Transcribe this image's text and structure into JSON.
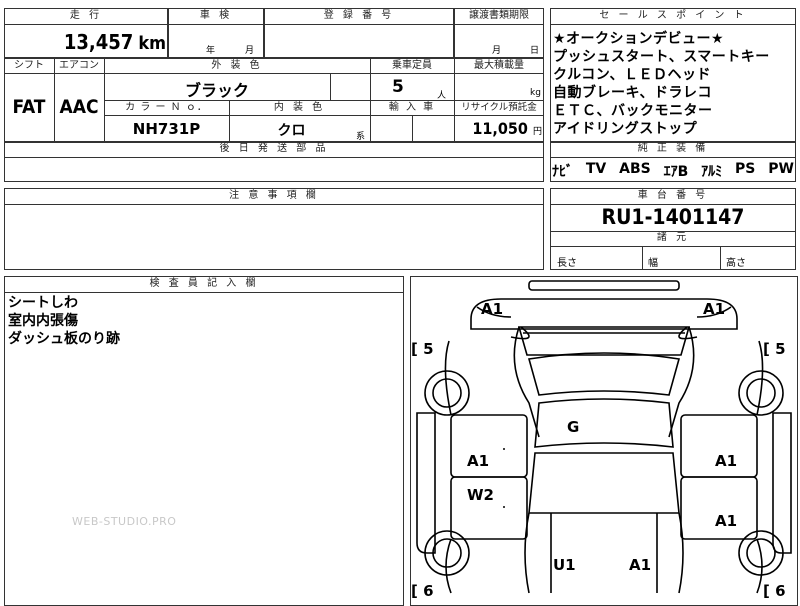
{
  "header": {
    "mileage_label": "走 行",
    "shaken_label": "車 検",
    "reg_label": "登 録 番 号",
    "transfer_label": "譲渡書類期限",
    "selling_label": "セ ー ル ス ポ イ ン ト"
  },
  "mileage": {
    "value": "13,457",
    "unit": "km"
  },
  "shaken": {
    "year_unit": "年",
    "month_unit": "月"
  },
  "transfer": {
    "month_unit": "月",
    "day_unit": "日"
  },
  "specs_headers": {
    "shift": "シフト",
    "aircon": "エアコン",
    "exterior": "外 装 色",
    "capacity": "乗車定員",
    "max_load": "最大積載量",
    "color_no": "カ ラ ー Ｎ ｏ．",
    "interior": "内 装 色",
    "import": "輸 入 車",
    "recycle": "リサイクル預託金"
  },
  "specs": {
    "shift": "FAT",
    "aircon": "AAC",
    "exterior_color": "ブラック",
    "capacity": "5",
    "capacity_unit": "人",
    "load_unit": "kg",
    "color_no": "NH731P",
    "interior_color": "クロ",
    "interior_suffix": "系",
    "recycle_value": "11,050",
    "recycle_unit": "円"
  },
  "selling_points": [
    "★オークションデビュー★",
    "プッシュスタート、スマートキー",
    "クルコン、ＬＥＤヘッド",
    "自動ブレーキ、ドラレコ",
    "ＥＴＣ、バックモニター",
    "アイドリングストップ"
  ],
  "later_parts_label": "後 日 発 送 部 品",
  "equipment": {
    "label": "純 正 装 備",
    "items": [
      "ﾅﾋﾞ",
      "TV",
      "ABS",
      "ｴｱB",
      "ｱﾙﾐ",
      "PS",
      "PW"
    ]
  },
  "caution_label": "注 意 事 項 欄",
  "chassis": {
    "label": "車 台 番 号",
    "number": "RU1-1401147"
  },
  "dimensions": {
    "label": "諸 元",
    "length": "長さ",
    "width": "幅",
    "height": "高さ"
  },
  "inspector": {
    "label": "検 査 員 記 入 欄",
    "notes": [
      "シートしわ",
      "室内内張傷",
      "ダッシュ板のり跡"
    ]
  },
  "watermark": "WEB-STUDIO.PRO",
  "diagram_marks": {
    "top_left": "A1",
    "top_right": "A1",
    "tire_fl": "[ 5",
    "tire_fr": "[ 5",
    "tire_rl": "[ 6",
    "tire_rr": "[ 6",
    "roof": "G",
    "left_front_door": "A1",
    "left_rear_door": "W2",
    "right_front_door": "A1",
    "right_rear_door": "A1",
    "rear_left": "U1",
    "rear_right": "A1"
  }
}
